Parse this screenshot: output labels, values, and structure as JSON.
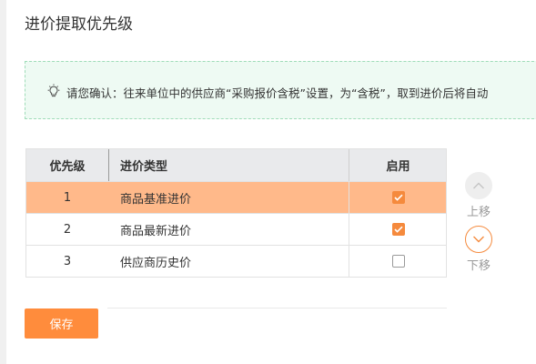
{
  "page": {
    "title": "进价提取优先级"
  },
  "notice": {
    "icon": "lightbulb-icon",
    "text": "请您确认：往来单位中的供应商“采购报价含税”设置，为“含税”，取到进价后将自动"
  },
  "table": {
    "headers": {
      "priority": "优先级",
      "type": "进价类型",
      "enable": "启用"
    },
    "rows": [
      {
        "priority": "1",
        "type": "商品基准进价",
        "enabled": true,
        "selected": true
      },
      {
        "priority": "2",
        "type": "商品最新进价",
        "enabled": true,
        "selected": false
      },
      {
        "priority": "3",
        "type": "供应商历史价",
        "enabled": false,
        "selected": false
      }
    ]
  },
  "controls": {
    "move_up_label": "上移",
    "move_down_label": "下移",
    "save_label": "保存"
  },
  "colors": {
    "accent": "#ff8c3c",
    "selected_row": "#ffb98a",
    "notice_bg": "#eefaf3",
    "notice_border": "#9fdcb8",
    "header_bg": "#e9eaec"
  }
}
